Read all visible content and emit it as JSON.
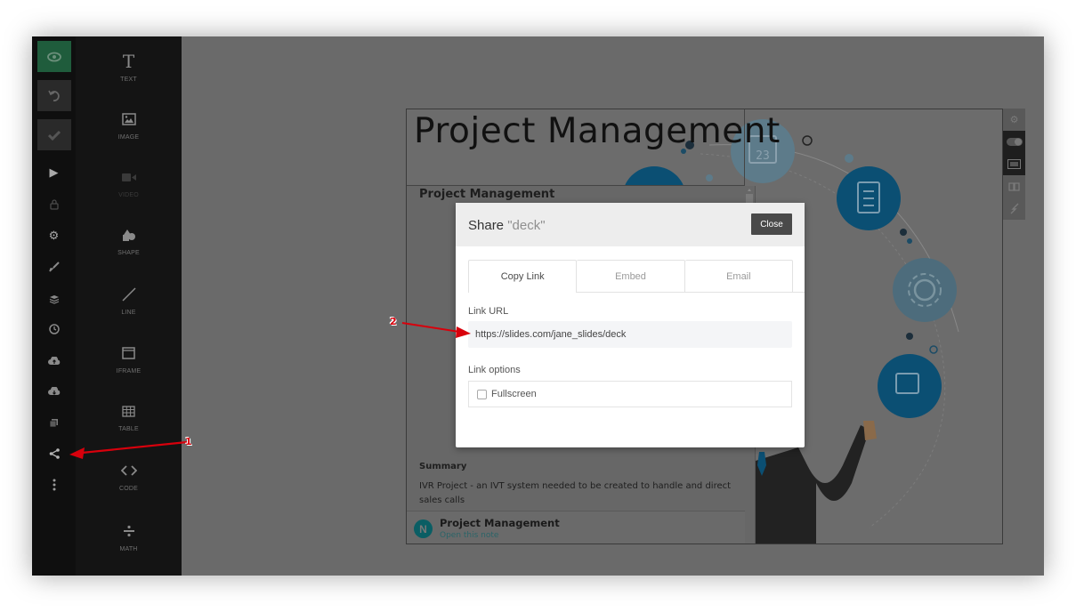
{
  "rail": {
    "items": [
      {
        "name": "preview",
        "icon": "eye-icon"
      },
      {
        "name": "undo",
        "icon": "undo-icon"
      },
      {
        "name": "save",
        "icon": "check-icon"
      },
      {
        "name": "present",
        "icon": "play-icon"
      },
      {
        "name": "lock",
        "icon": "lock-icon"
      },
      {
        "name": "settings",
        "icon": "gear-icon"
      },
      {
        "name": "style",
        "icon": "brush-icon"
      },
      {
        "name": "layers",
        "icon": "layers-icon"
      },
      {
        "name": "history",
        "icon": "clock-icon"
      },
      {
        "name": "upload",
        "icon": "cloud-upload-icon"
      },
      {
        "name": "download",
        "icon": "cloud-download-icon"
      },
      {
        "name": "media",
        "icon": "image-stack-icon"
      },
      {
        "name": "share",
        "icon": "share-icon"
      },
      {
        "name": "more",
        "icon": "more-vertical-icon"
      }
    ]
  },
  "tools": [
    {
      "label": "TEXT",
      "icon": "text-icon"
    },
    {
      "label": "IMAGE",
      "icon": "image-icon"
    },
    {
      "label": "VIDEO",
      "icon": "video-icon"
    },
    {
      "label": "SHAPE",
      "icon": "shape-icon"
    },
    {
      "label": "LINE",
      "icon": "line-icon"
    },
    {
      "label": "IFRAME",
      "icon": "iframe-icon"
    },
    {
      "label": "TABLE",
      "icon": "table-icon"
    },
    {
      "label": "CODE",
      "icon": "code-icon"
    },
    {
      "label": "MATH",
      "icon": "math-icon"
    }
  ],
  "slide": {
    "title": "Project Management",
    "note": {
      "heading": "Project Management",
      "summary_heading": "Summary",
      "summary_text": "IVR Project - an IVT system needed to be created to handle and direct sales calls",
      "footer_title": "Project Management",
      "footer_link": "Open this note",
      "logo_letter": "N"
    },
    "calendar_number": "23"
  },
  "mini_toolbar": [
    "gear-icon",
    "toggle-icon",
    "slide-frame-icon",
    "book-icon",
    "lightning-icon"
  ],
  "modal": {
    "title_prefix": "Share",
    "title_name": "\"deck\"",
    "close_label": "Close",
    "tabs": [
      {
        "label": "Copy Link",
        "active": true
      },
      {
        "label": "Embed",
        "active": false
      },
      {
        "label": "Email",
        "active": false
      }
    ],
    "link_url_label": "Link URL",
    "link_url_value": "https://slides.com/jane_slides/deck",
    "link_options_label": "Link options",
    "fullscreen_label": "Fullscreen",
    "fullscreen_checked": false
  },
  "annotations": [
    {
      "number": "1",
      "color": "#d8000c"
    },
    {
      "number": "2",
      "color": "#d8000c"
    }
  ],
  "colors": {
    "accent_green": "#1f5c3c",
    "annotation_red": "#d8000c",
    "illustration_blue": "#0b4f73"
  }
}
